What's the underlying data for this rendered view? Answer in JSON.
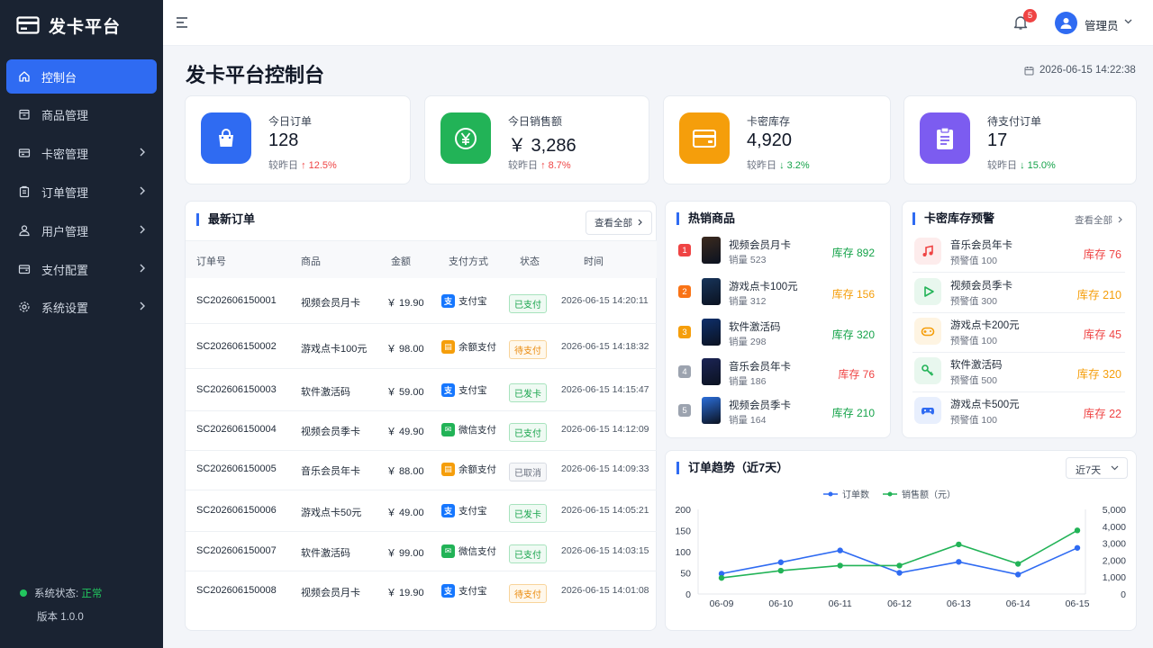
{
  "app": {
    "name": "发卡平台"
  },
  "sidebar": {
    "items": [
      {
        "label": "控制台",
        "icon": "home-icon",
        "active": true
      },
      {
        "label": "商品管理",
        "icon": "box-icon"
      },
      {
        "label": "卡密管理",
        "icon": "card-icon"
      },
      {
        "label": "订单管理",
        "icon": "clipboard-icon"
      },
      {
        "label": "用户管理",
        "icon": "user-icon"
      },
      {
        "label": "支付配置",
        "icon": "wallet-icon"
      },
      {
        "label": "系统设置",
        "icon": "gear-icon"
      }
    ],
    "status_label": "系统状态:",
    "status_value": "正常",
    "version": "版本 1.0.0"
  },
  "topbar": {
    "notification_count": "5",
    "admin_name": "管理员"
  },
  "page": {
    "title": "发卡平台控制台",
    "datetime": "2026-06-15 14:22:38"
  },
  "stats": [
    {
      "label": "今日订单",
      "value": "128",
      "compare": "较昨日",
      "trend": "↑ 12.5%",
      "dir": "up",
      "color": "#2f6bf2",
      "icon": "shopping-bag-icon"
    },
    {
      "label": "今日销售额",
      "value": "￥ 3,286",
      "compare": "较昨日",
      "trend": "↑ 8.7%",
      "dir": "up",
      "color": "#22b357",
      "icon": "yen-icon"
    },
    {
      "label": "卡密库存",
      "value": "4,920",
      "compare": "较昨日",
      "trend": "↓ 3.2%",
      "dir": "down",
      "color": "#f59e0b",
      "icon": "credit-card-icon"
    },
    {
      "label": "待支付订单",
      "value": "17",
      "compare": "较昨日",
      "trend": "↓ 15.0%",
      "dir": "down",
      "color": "#7c5cf0",
      "icon": "clipboard-list-icon"
    }
  ],
  "orders": {
    "title": "最新订单",
    "view_all": "查看全部",
    "columns": [
      "订单号",
      "商品",
      "金额",
      "支付方式",
      "状态",
      "时间"
    ],
    "rows": [
      {
        "id": "SC202606150001",
        "product": "视频会员月卡",
        "amount": "￥ 19.90",
        "pay": "支付宝",
        "status": "已支付",
        "time": "2026-06-15 14:20:11"
      },
      {
        "id": "SC202606150002",
        "product": "游戏点卡100元",
        "amount": "￥ 98.00",
        "pay": "余额支付",
        "status": "待支付",
        "time": "2026-06-15 14:18:32"
      },
      {
        "id": "SC202606150003",
        "product": "软件激活码",
        "amount": "￥ 59.00",
        "pay": "支付宝",
        "status": "已发卡",
        "time": "2026-06-15 14:15:47"
      },
      {
        "id": "SC202606150004",
        "product": "视频会员季卡",
        "amount": "￥ 49.90",
        "pay": "微信支付",
        "status": "已支付",
        "time": "2026-06-15 14:12:09"
      },
      {
        "id": "SC202606150005",
        "product": "音乐会员年卡",
        "amount": "￥ 88.00",
        "pay": "余额支付",
        "status": "已取消",
        "time": "2026-06-15 14:09:33"
      },
      {
        "id": "SC202606150006",
        "product": "游戏点卡50元",
        "amount": "￥ 49.00",
        "pay": "支付宝",
        "status": "已发卡",
        "time": "2026-06-15 14:05:21"
      },
      {
        "id": "SC202606150007",
        "product": "软件激活码",
        "amount": "￥ 99.00",
        "pay": "微信支付",
        "status": "已支付",
        "time": "2026-06-15 14:03:15"
      },
      {
        "id": "SC202606150008",
        "product": "视频会员月卡",
        "amount": "￥ 19.90",
        "pay": "支付宝",
        "status": "待支付",
        "time": "2026-06-15 14:01:08"
      }
    ]
  },
  "hot": {
    "title": "热销商品",
    "items": [
      {
        "rank": "1",
        "name": "视频会员月卡",
        "sales": "销量 523",
        "stock": "库存 892",
        "stock_color": "green",
        "rank_color": "#ef4444"
      },
      {
        "rank": "2",
        "name": "游戏点卡100元",
        "sales": "销量 312",
        "stock": "库存 156",
        "stock_color": "orange",
        "rank_color": "#f97316"
      },
      {
        "rank": "3",
        "name": "软件激活码",
        "sales": "销量 298",
        "stock": "库存 320",
        "stock_color": "green",
        "rank_color": "#f59e0b"
      },
      {
        "rank": "4",
        "name": "音乐会员年卡",
        "sales": "销量 186",
        "stock": "库存 76",
        "stock_color": "red",
        "rank_color": "#9ca3af"
      },
      {
        "rank": "5",
        "name": "视频会员季卡",
        "sales": "销量 164",
        "stock": "库存 210",
        "stock_color": "green",
        "rank_color": "#9ca3af"
      }
    ]
  },
  "alerts": {
    "title": "卡密库存预警",
    "view_all": "查看全部",
    "items": [
      {
        "name": "音乐会员年卡",
        "warn": "预警值 100",
        "stock": "库存 76",
        "stock_color": "red",
        "icon": "music-icon",
        "icon_color": "#ef4444",
        "bg": "#fdecec"
      },
      {
        "name": "视频会员季卡",
        "warn": "预警值 300",
        "stock": "库存 210",
        "stock_color": "orange",
        "icon": "play-icon",
        "icon_color": "#22b357",
        "bg": "#e8f7ee"
      },
      {
        "name": "游戏点卡200元",
        "warn": "预警值 100",
        "stock": "库存 45",
        "stock_color": "red",
        "icon": "gamepad-icon",
        "icon_color": "#f59e0b",
        "bg": "#fef4e2"
      },
      {
        "name": "软件激活码",
        "warn": "预警值 500",
        "stock": "库存 320",
        "stock_color": "orange",
        "icon": "key-icon",
        "icon_color": "#22b357",
        "bg": "#e8f7ee"
      },
      {
        "name": "游戏点卡500元",
        "warn": "预警值 100",
        "stock": "库存 22",
        "stock_color": "red",
        "icon": "controller-icon",
        "icon_color": "#2f6bf2",
        "bg": "#e8effd"
      }
    ]
  },
  "trend": {
    "title": "订单趋势（近7天）",
    "range": "近7天"
  },
  "chart_data": {
    "type": "line",
    "categories": [
      "06-09",
      "06-10",
      "06-11",
      "06-12",
      "06-13",
      "06-14",
      "06-15"
    ],
    "series": [
      {
        "name": "订单数",
        "axis": "left",
        "color": "#2f6bf2",
        "values": [
          48,
          75,
          103,
          50,
          76,
          46,
          109
        ]
      },
      {
        "name": "销售额（元）",
        "axis": "right",
        "color": "#22b357",
        "values": [
          950,
          1380,
          1680,
          1680,
          2930,
          1780,
          3760
        ]
      }
    ],
    "y_left": {
      "ticks": [
        "0",
        "50",
        "100",
        "150",
        "200"
      ],
      "range": [
        0,
        200
      ]
    },
    "y_right": {
      "ticks": [
        "0",
        "1,000",
        "2,000",
        "3,000",
        "4,000",
        "5,000"
      ],
      "range": [
        0,
        5000
      ]
    },
    "legend_position": "top-center",
    "grid": false
  }
}
